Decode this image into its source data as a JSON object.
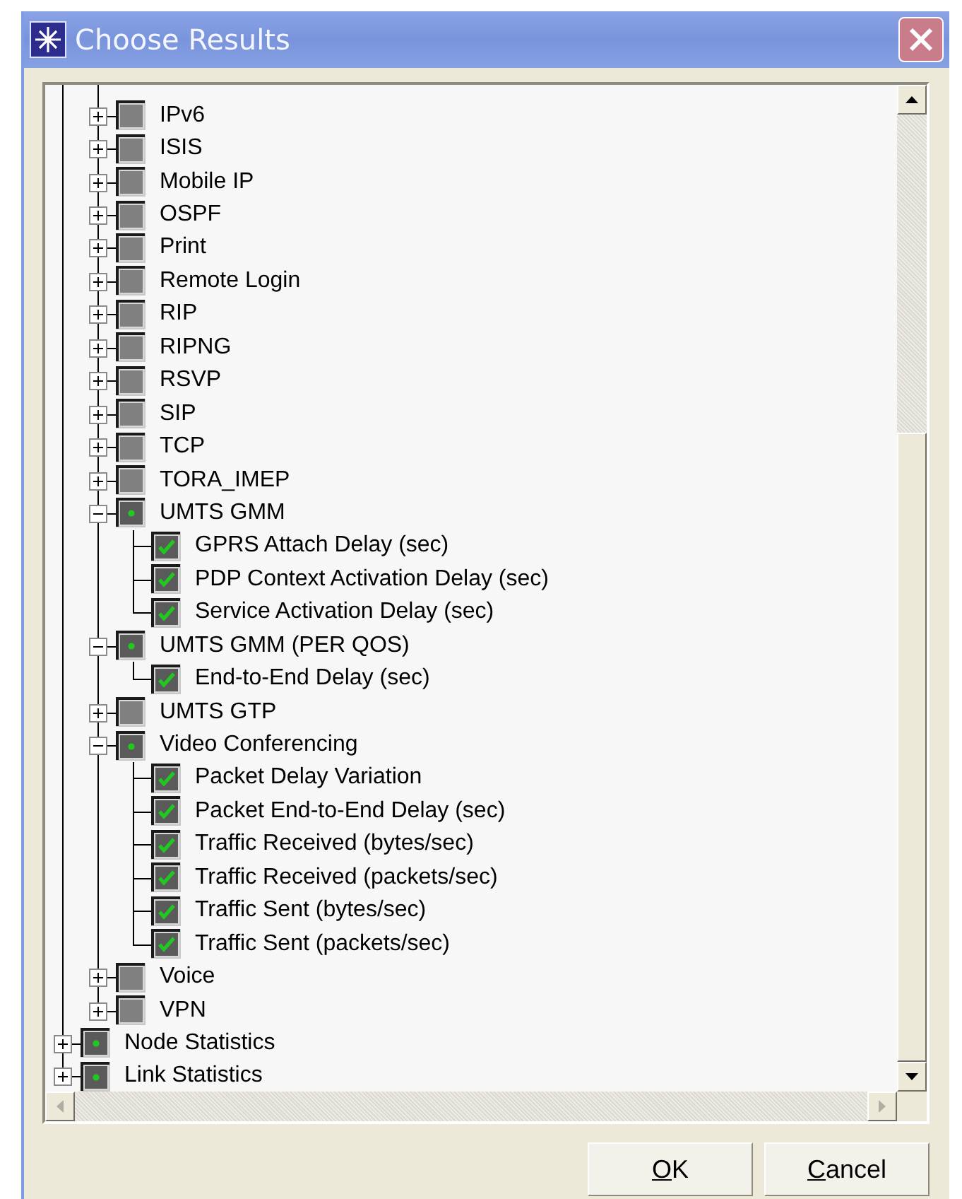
{
  "window": {
    "title": "Choose Results"
  },
  "tree": [
    {
      "children": [
        {
          "label": "IPv6",
          "partial": false,
          "expanded": false
        },
        {
          "label": "ISIS",
          "partial": false,
          "expanded": false
        },
        {
          "label": "Mobile IP",
          "partial": false,
          "expanded": false
        },
        {
          "label": "OSPF",
          "partial": false,
          "expanded": false
        },
        {
          "label": "Print",
          "partial": false,
          "expanded": false
        },
        {
          "label": "Remote Login",
          "partial": false,
          "expanded": false
        },
        {
          "label": "RIP",
          "partial": false,
          "expanded": false
        },
        {
          "label": "RIPNG",
          "partial": false,
          "expanded": false
        },
        {
          "label": "RSVP",
          "partial": false,
          "expanded": false
        },
        {
          "label": "SIP",
          "partial": false,
          "expanded": false
        },
        {
          "label": "TCP",
          "partial": false,
          "expanded": false
        },
        {
          "label": "TORA_IMEP",
          "partial": false,
          "expanded": false
        },
        {
          "label": "UMTS GMM",
          "partial": true,
          "expanded": true,
          "children": [
            {
              "label": "GPRS Attach Delay (sec)",
              "checked": true
            },
            {
              "label": "PDP Context Activation Delay (sec)",
              "checked": true
            },
            {
              "label": "Service Activation Delay (sec)",
              "checked": true
            }
          ]
        },
        {
          "label": "UMTS GMM (PER QOS)",
          "partial": true,
          "expanded": true,
          "children": [
            {
              "label": "End-to-End Delay (sec)",
              "checked": true
            }
          ]
        },
        {
          "label": "UMTS GTP",
          "partial": false,
          "expanded": false
        },
        {
          "label": "Video Conferencing",
          "partial": true,
          "expanded": true,
          "children": [
            {
              "label": "Packet Delay Variation",
              "checked": true
            },
            {
              "label": "Packet End-to-End Delay (sec)",
              "checked": true
            },
            {
              "label": "Traffic Received (bytes/sec)",
              "checked": true
            },
            {
              "label": "Traffic Received (packets/sec)",
              "checked": true
            },
            {
              "label": "Traffic Sent (bytes/sec)",
              "checked": true
            },
            {
              "label": "Traffic Sent (packets/sec)",
              "checked": true
            }
          ]
        },
        {
          "label": "Voice",
          "partial": false,
          "expanded": false
        },
        {
          "label": "VPN",
          "partial": false,
          "expanded": false
        }
      ]
    },
    {
      "label": "Node Statistics",
      "partial": true,
      "expanded": false
    },
    {
      "label": "Link Statistics",
      "partial": true,
      "expanded": false
    }
  ],
  "buttons": [
    "OK",
    "Cancel"
  ]
}
